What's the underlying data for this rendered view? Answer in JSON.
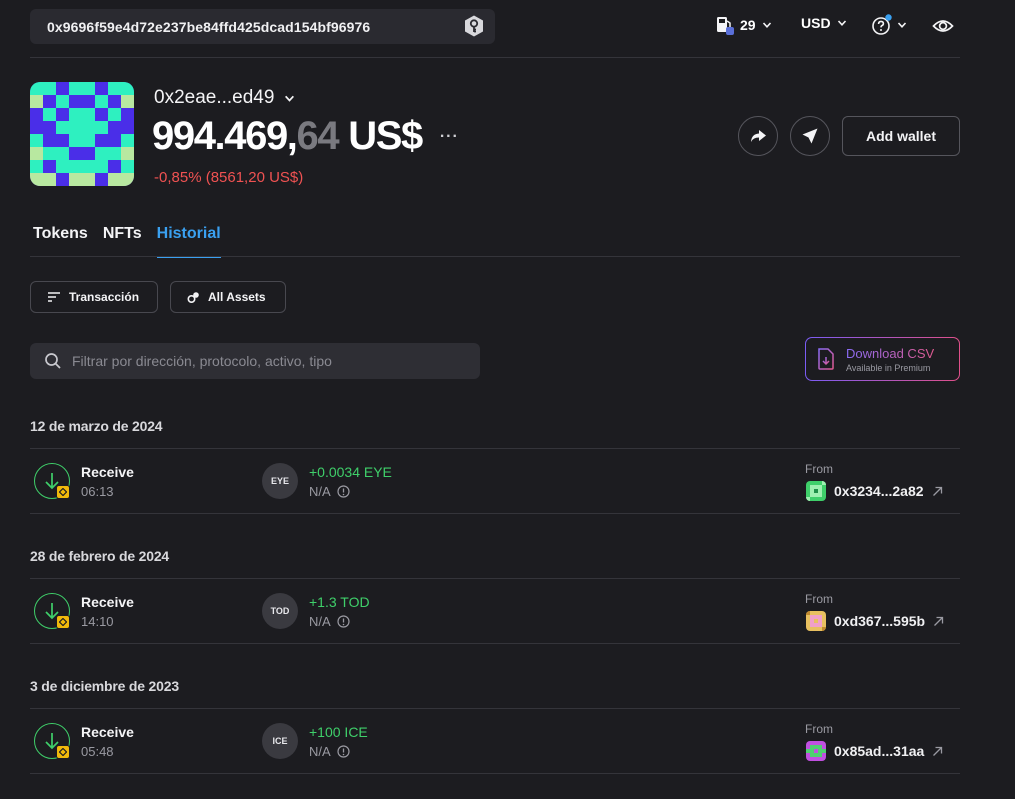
{
  "top_bar": {
    "address": "0x9696f59e4d72e237be84ffd425dcad154bf96976",
    "gas_value": "29",
    "currency": "USD",
    "gas_icon": "fuel-pump-icon",
    "help_icon": "question-circle-icon",
    "eye_icon": "eye-icon"
  },
  "account": {
    "name": "0x2eae...ed49",
    "balance_int": "994.469,",
    "balance_dec": "64",
    "balance_currency": "US$",
    "more": "···",
    "change": "-0,85% (8561,20 US$)",
    "add_wallet": "Add wallet"
  },
  "tabs": [
    {
      "label": "Tokens"
    },
    {
      "label": "NFTs"
    },
    {
      "label": "Historial"
    }
  ],
  "filters": {
    "transaction": "Transacción",
    "assets": "All Assets",
    "search_placeholder": "Filtrar por dirección, protocolo, activo, tipo",
    "csv_title": "Download CSV",
    "csv_sub": "Available in Premium"
  },
  "history": [
    {
      "date": "12 de marzo de 2024",
      "type": "Receive",
      "time": "06:13",
      "token": "EYE",
      "amount": "+0.0034 EYE",
      "usd": "N/A",
      "from_label": "From",
      "from": "0x3234...2a82"
    },
    {
      "date": "28 de febrero de 2024",
      "type": "Receive",
      "time": "14:10",
      "token": "TOD",
      "amount": "+1.3 TOD",
      "usd": "N/A",
      "from_label": "From",
      "from": "0xd367...595b"
    },
    {
      "date": "3 de diciembre de 2023",
      "type": "Receive",
      "time": "05:48",
      "token": "ICE",
      "amount": "+100 ICE",
      "usd": "N/A",
      "from_label": "From",
      "from": "0x85ad...31aa"
    }
  ],
  "colors": {
    "accent": "#3aa0f0",
    "positive": "#3fcf6a",
    "negative": "#f05252",
    "background": "#1c1c20"
  }
}
